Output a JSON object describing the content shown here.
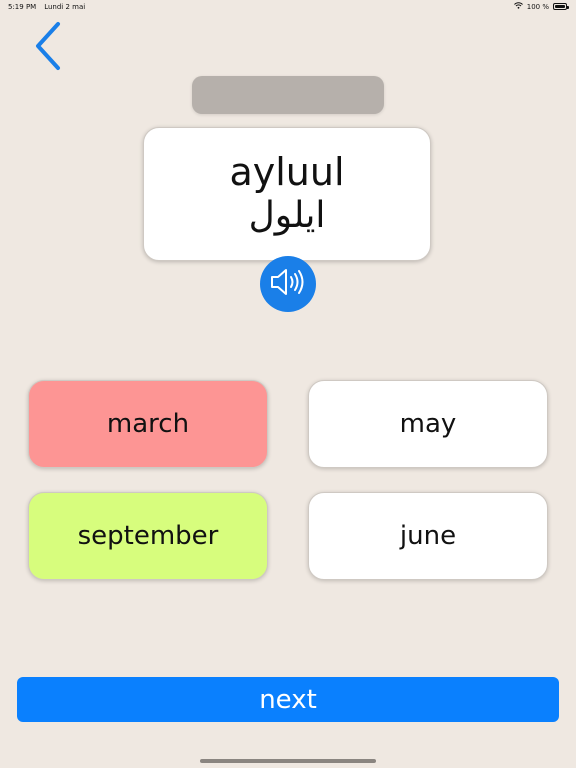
{
  "status_bar": {
    "time": "5:19 PM",
    "date": "Lundi 2 mai",
    "battery_text": "100 %",
    "battery_level": 1.0,
    "wifi_icon": "wifi-icon",
    "battery_icon": "battery-icon"
  },
  "nav": {
    "back_icon": "chevron-left-icon",
    "accent_color": "#1a7fe8"
  },
  "word": {
    "latin": "ayluul",
    "arabic": "ايلول"
  },
  "speaker": {
    "icon": "speaker-icon",
    "color": "#1a7fe8"
  },
  "options": [
    {
      "label": "march",
      "state": "incorrect",
      "color": "#fd9594"
    },
    {
      "label": "may",
      "state": "neutral",
      "color": "#ffffff"
    },
    {
      "label": "september",
      "state": "correct",
      "color": "#d7fd7d"
    },
    {
      "label": "june",
      "state": "neutral",
      "color": "#ffffff"
    }
  ],
  "footer": {
    "next_label": "next",
    "next_color": "#0a80fe"
  }
}
